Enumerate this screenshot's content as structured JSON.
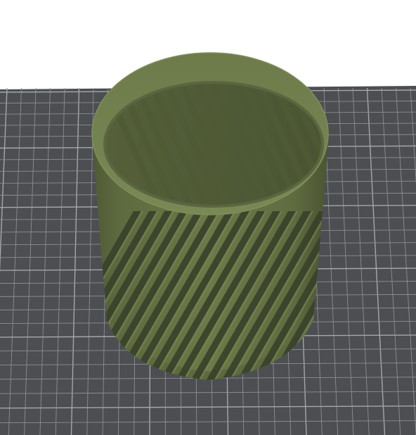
{
  "viewport": {
    "background_color": "#ffffff",
    "bed": {
      "surface_color": "#4c4e52",
      "grid_line_color": "#8b8e92",
      "grid_major_line_color": "#a4a7ab"
    },
    "model": {
      "shape": "cylindrical-basket-with-diagonal-slots",
      "color_face": "#6b7a48",
      "color_light": "#7a8a55",
      "color_dark": "#4f5a35",
      "color_shadow": "#39412a",
      "selected": false
    }
  }
}
